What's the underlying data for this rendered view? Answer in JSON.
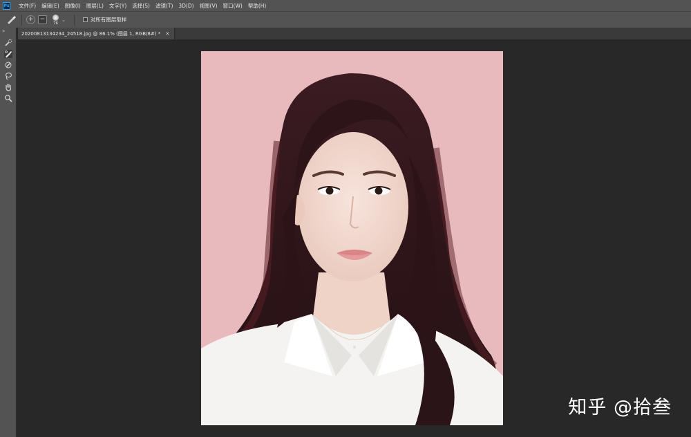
{
  "app": {
    "logo": "Ps"
  },
  "menu": [
    "文件(F)",
    "编辑(E)",
    "图像(I)",
    "图层(L)",
    "文字(Y)",
    "选择(S)",
    "滤镜(T)",
    "3D(D)",
    "视图(V)",
    "窗口(W)",
    "帮助(H)"
  ],
  "options": {
    "brush_size": "76",
    "sample_all_layers_label": "对所有图层取样",
    "sample_all_layers_checked": false
  },
  "tab": {
    "title": "20200813134234_24518.jpg @ 86.1% (图层 1, RGB/8#) *",
    "close": "×"
  },
  "toolbar": {
    "collapse": "»",
    "tools": [
      "quick-selection-icon",
      "select-and-mask-brush-icon",
      "refine-edge-brush-icon",
      "lasso-icon",
      "hand-icon",
      "zoom-icon"
    ],
    "selected_index": 1
  },
  "canvas": {
    "background_color": "#e9bcbf"
  },
  "watermark": "知乎 @拾叁"
}
